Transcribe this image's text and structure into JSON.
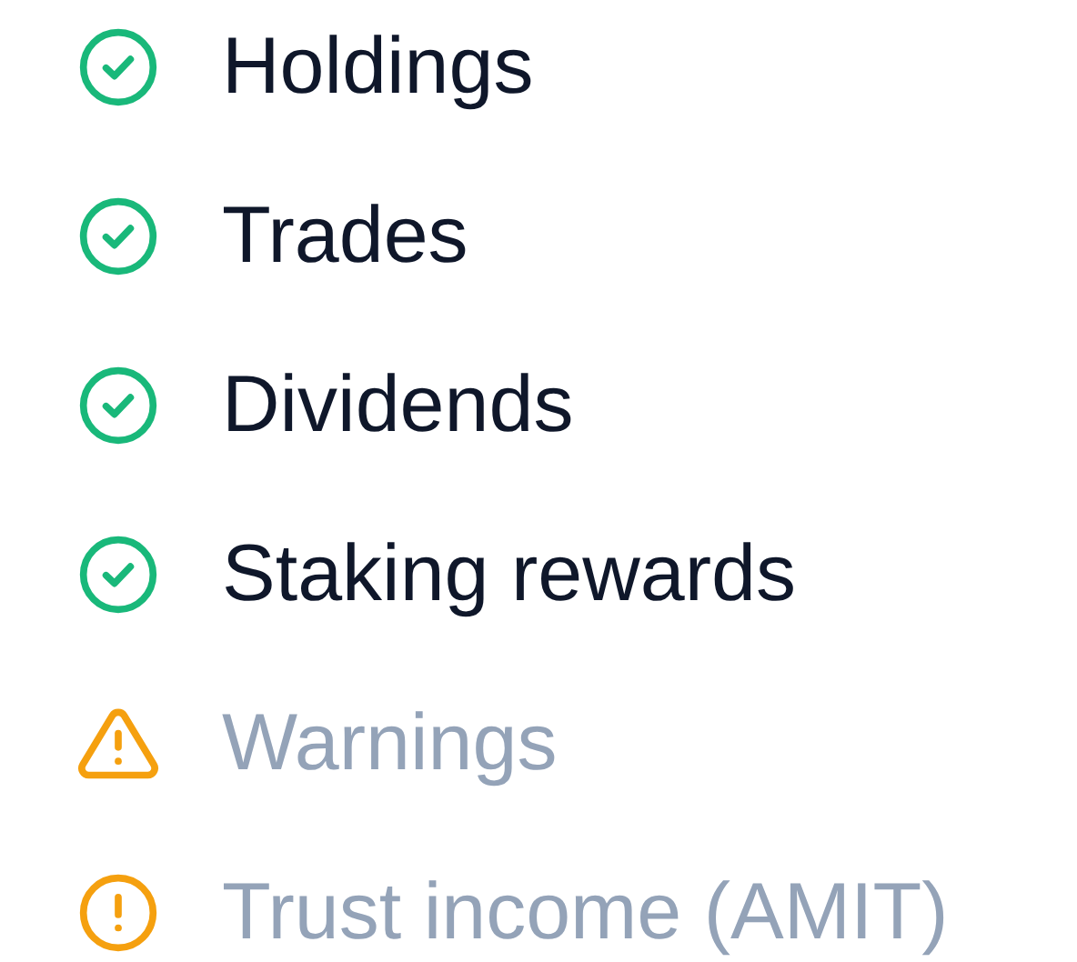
{
  "items": [
    {
      "kind": "check",
      "label": "Holdings"
    },
    {
      "kind": "check",
      "label": "Trades"
    },
    {
      "kind": "check",
      "label": "Dividends"
    },
    {
      "kind": "check",
      "label": "Staking rewards"
    },
    {
      "kind": "warning",
      "label": "Warnings"
    },
    {
      "kind": "alert",
      "label": "Trust income (AMIT)"
    }
  ]
}
